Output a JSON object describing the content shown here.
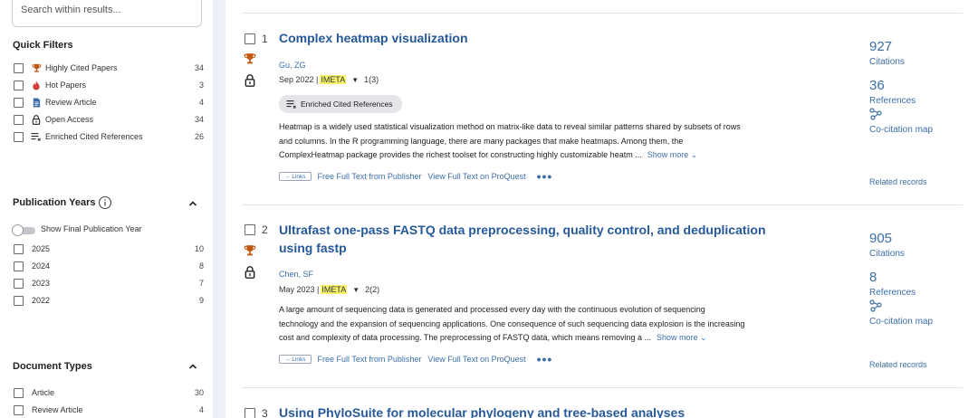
{
  "search": {
    "placeholder": "Search within results..."
  },
  "quick_filters": {
    "title": "Quick Filters",
    "items": [
      {
        "label": "Highly Cited Papers",
        "count": "34",
        "icon": "trophy-icon"
      },
      {
        "label": "Hot Papers",
        "count": "3",
        "icon": "flame-icon"
      },
      {
        "label": "Review Article",
        "count": "4",
        "icon": "document-icon"
      },
      {
        "label": "Open Access",
        "count": "34",
        "icon": "lock-open-icon"
      },
      {
        "label": "Enriched Cited References",
        "count": "26",
        "icon": "list-icon"
      }
    ]
  },
  "publication_years": {
    "title": "Publication Years",
    "toggle_label": "Show Final Publication Year",
    "items": [
      {
        "label": "2025",
        "count": "10"
      },
      {
        "label": "2024",
        "count": "8"
      },
      {
        "label": "2023",
        "count": "7"
      },
      {
        "label": "2022",
        "count": "9"
      }
    ]
  },
  "document_types": {
    "title": "Document Types",
    "items": [
      {
        "label": "Article",
        "count": "30"
      },
      {
        "label": "Review Article",
        "count": "4"
      }
    ]
  },
  "records": [
    {
      "number": "1",
      "title": "Complex heatmap visualization",
      "author": "Gu, ZG",
      "date": "Sep 2022 |",
      "journal": "IMETA",
      "issue": "1(3)",
      "pill": "Enriched Cited References",
      "abstract_lines": [
        "Heatmap is a widely used statistical visualization method on matrix-like data to reveal similar patterns shared by subsets of rows",
        "and columns. In the R programming language, there are many packages that make heatmaps. Among them, the",
        "ComplexHeatmap package provides the richest toolset for constructing highly customizable heatm ..."
      ],
      "show_more": "Show more",
      "links_label": "Links",
      "free_full_text": "Free Full Text from Publisher",
      "proquest": "View Full Text on ProQuest",
      "citations": "927",
      "citations_label": "Citations",
      "references": "36",
      "references_label": "References",
      "cocitation": "Co-citation map",
      "related": "Related records"
    },
    {
      "number": "2",
      "title": "Ultrafast one-pass FASTQ data preprocessing, quality control, and deduplication using fastp",
      "author": "Chen, SF",
      "date": "May 2023 |",
      "journal": "IMETA",
      "issue": "2(2)",
      "abstract_lines": [
        "A large amount of sequencing data is generated and processed every day with the continuous evolution of sequencing",
        "technology and the expansion of sequencing applications. One consequence of such sequencing data explosion is the increasing",
        "cost and complexity of data processing. The preprocessing of FASTQ data, which means removing a ..."
      ],
      "show_more": "Show more",
      "links_label": "Links",
      "free_full_text": "Free Full Text from Publisher",
      "proquest": "View Full Text on ProQuest",
      "citations": "905",
      "citations_label": "Citations",
      "references": "8",
      "references_label": "References",
      "cocitation": "Co-citation map",
      "related": "Related records"
    },
    {
      "number": "3",
      "title": "Using PhyloSuite for molecular phylogeny and tree-based analyses"
    }
  ],
  "colors": {
    "link": "#3b6ea8",
    "title": "#26599a",
    "highlight": "#f7f36b",
    "trophy": "#c0580f"
  }
}
